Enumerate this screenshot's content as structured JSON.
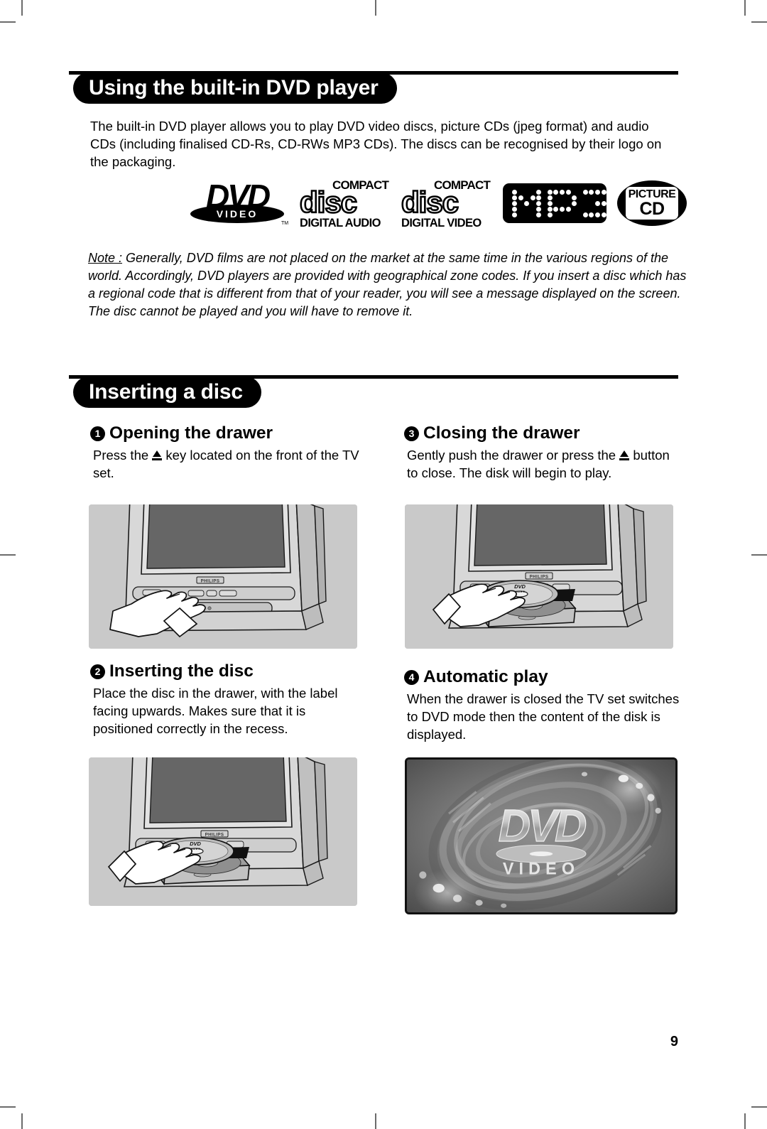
{
  "document": {
    "page_number": "9"
  },
  "section1": {
    "title": "Using the built-in DVD player",
    "intro": "The built-in DVD player allows you to play DVD video discs, picture CDs (jpeg format) and audio CDs (including finalised CD-Rs, CD-RWs MP3 CDs). The discs can be recognised by their logo on the packaging.",
    "note_label": "Note :",
    "note_text": " Generally, DVD films are not placed on the market at the same time in the various regions of the world. Accordingly, DVD players are provided with geographical zone codes. If you insert a disc which has a regional code that is different from that of your reader, you will see a message displayed on the screen. The disc cannot be played and you will have to remove it.",
    "logos": {
      "dvd": {
        "name": "dvd-video-logo",
        "main": "DVD",
        "sub": "VIDEO",
        "tm": "TM"
      },
      "cd_audio": {
        "name": "compact-disc-digital-audio-logo",
        "top": "COMPACT",
        "mid": "disc",
        "bottom": "DIGITAL AUDIO"
      },
      "cd_video": {
        "name": "compact-disc-digital-video-logo",
        "top": "COMPACT",
        "mid": "disc",
        "bottom": "DIGITAL VIDEO"
      },
      "mp3": {
        "name": "mp3-logo",
        "label": "MP3"
      },
      "picture_cd": {
        "name": "picture-cd-logo",
        "top": "PICTURE",
        "bottom": "CD"
      }
    }
  },
  "section2": {
    "title": "Inserting a disc",
    "steps": [
      {
        "number": "1",
        "title": "Opening the drawer",
        "text_before": "Press the ",
        "icon": "eject-icon",
        "text_after": " key located on the front of the TV set.",
        "image": "tv-front-hand-pressing-eject-button"
      },
      {
        "number": "2",
        "title": "Inserting the disc",
        "text_before": "Place the disc in the drawer, with the label facing upwards. Makes sure that it is positioned correctly in the recess.",
        "icon": "",
        "text_after": "",
        "image": "tv-open-drawer-hand-placing-disc"
      },
      {
        "number": "3",
        "title": "Closing the drawer",
        "text_before": "Gently push the drawer or press the ",
        "icon": "eject-icon",
        "text_after": " button to close. The disk will begin to play.",
        "image": "tv-open-drawer-with-disc-loaded"
      },
      {
        "number": "4",
        "title": "Automatic play",
        "text_before": "When the drawer is closed the TV set switches to DVD mode then the content of the disk is displayed.",
        "icon": "",
        "text_after": "",
        "image": "dvd-video-splash-screen"
      }
    ]
  },
  "illustrations": {
    "tv_brand": "PHILIPS",
    "disc_label_line1": "DVD",
    "disc_label_line2": "VIDEO",
    "splash_main": "DVD",
    "splash_sub": "VIDEO"
  },
  "colors": {
    "ink": "#000000",
    "paper": "#ffffff",
    "panel_bg": "#c9c9c9",
    "screen_dark": "#666666",
    "crop_mark": "#6b6b6b"
  }
}
